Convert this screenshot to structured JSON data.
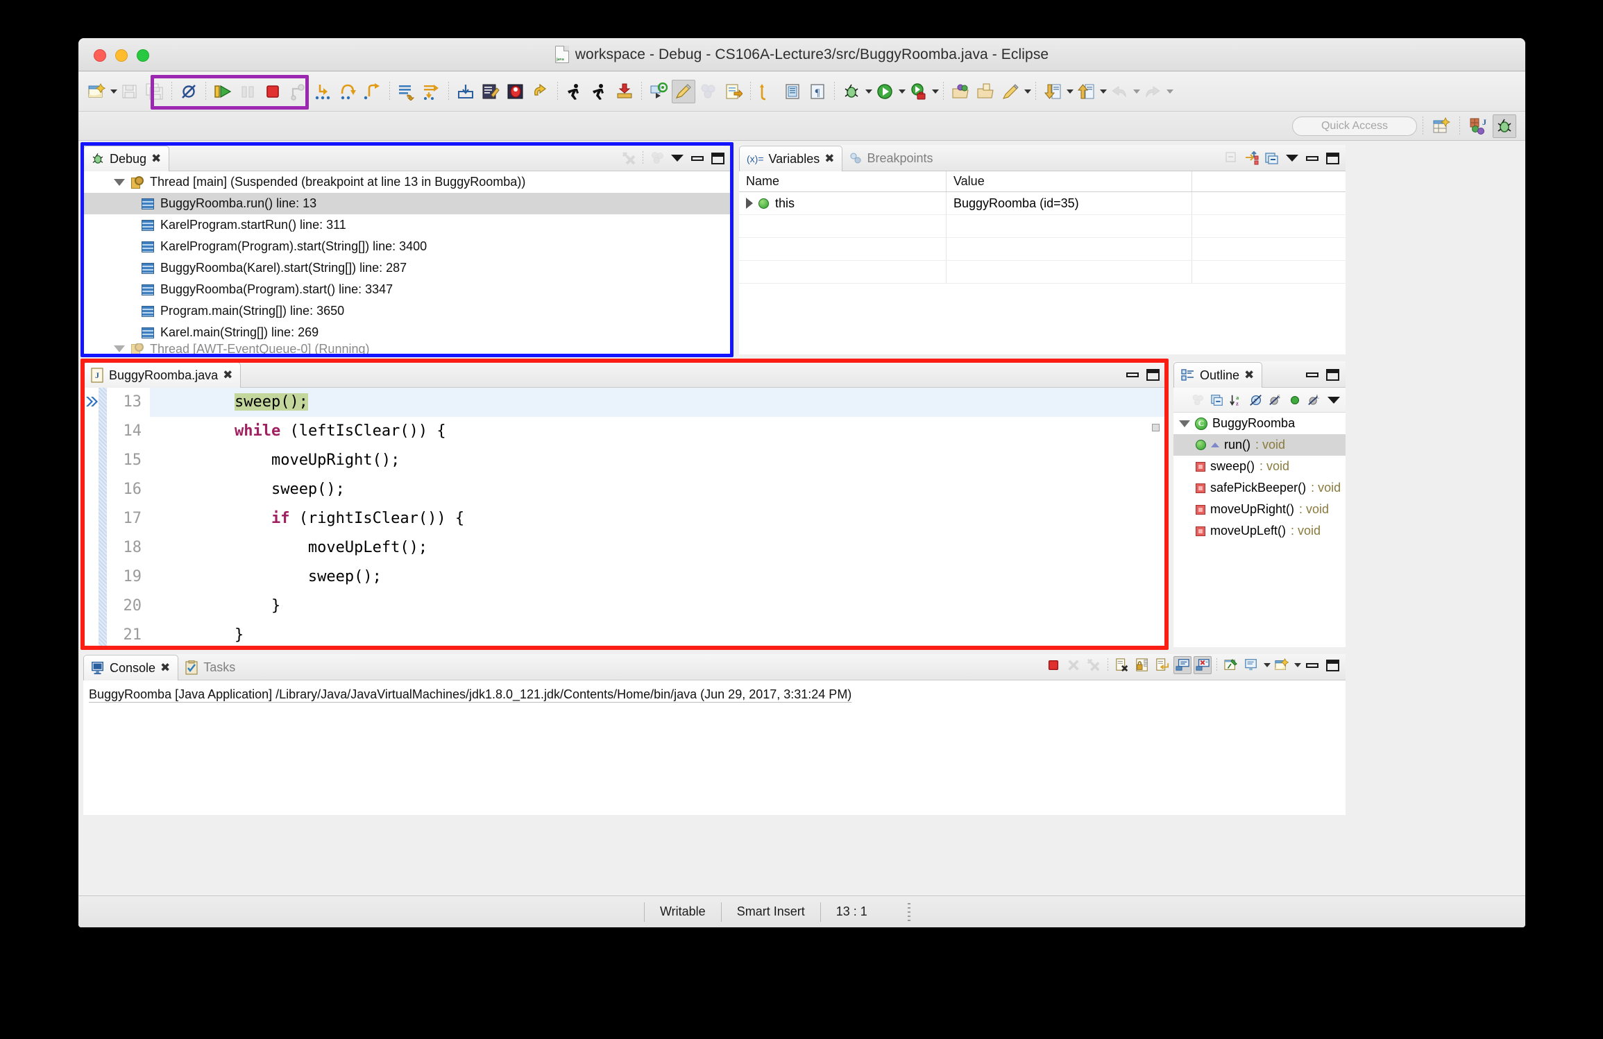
{
  "window": {
    "title": "workspace - Debug - CS106A-Lecture3/src/BuggyRoomba.java - Eclipse",
    "title_icon": "java-file-icon"
  },
  "toolbar": {
    "quick_access_placeholder": "Quick Access",
    "left_items": [
      {
        "name": "new-wizard-button",
        "icon": "new-document-icon",
        "has_dropdown": true,
        "enabled": true
      },
      {
        "name": "save-button",
        "icon": "save-disk-icon",
        "enabled": false
      },
      {
        "name": "save-all-button",
        "icon": "save-all-disks-icon",
        "enabled": false
      },
      {
        "name": "skip-all-breakpoints-button",
        "icon": "breakpoint-skip-icon",
        "enabled": true
      }
    ],
    "debug_controls": [
      {
        "name": "resume-button",
        "icon": "resume-play-icon",
        "enabled": true
      },
      {
        "name": "suspend-button",
        "icon": "suspend-pause-icon",
        "enabled": false
      },
      {
        "name": "terminate-button",
        "icon": "terminate-stop-icon",
        "enabled": true
      },
      {
        "name": "disconnect-button",
        "icon": "disconnect-icon",
        "enabled": false
      },
      {
        "name": "step-into-button",
        "icon": "step-into-arrow-icon",
        "enabled": true
      },
      {
        "name": "step-over-button",
        "icon": "step-over-arrow-icon",
        "enabled": true
      },
      {
        "name": "step-return-button",
        "icon": "step-return-arrow-icon",
        "enabled": true
      }
    ],
    "right_items": [
      {
        "name": "next-annotation-button",
        "icon": "next-annotation-icon"
      },
      {
        "name": "step-by-step-button",
        "icon": "step-filter-icon"
      },
      {
        "name": "open-type-button",
        "icon": "open-type-icon"
      },
      {
        "name": "new-java-project-button",
        "icon": "new-java-project-icon"
      },
      {
        "name": "debug-perspective-button",
        "icon": "bug-red-icon"
      },
      {
        "name": "toggle-mark-occurrences-button",
        "icon": "yellow-arrows-icon"
      },
      {
        "name": "run-last-tool-button",
        "icon": "running-man-icon"
      },
      {
        "name": "external-tools-button",
        "icon": "running-man-2-icon"
      },
      {
        "name": "build-button",
        "icon": "build-download-icon"
      },
      {
        "name": "new-class-button",
        "icon": "new-class-icon"
      },
      {
        "name": "toggle-highlight-button",
        "icon": "paintbrush-icon",
        "pressed": true
      },
      {
        "name": "coverage-button",
        "icon": "coverage-spheres-icon",
        "enabled": false
      },
      {
        "name": "open-task-button",
        "icon": "open-task-icon"
      },
      {
        "name": "open-terminal-button",
        "icon": "terminal-icon"
      },
      {
        "name": "show-whitespace-button",
        "icon": "pilcrow-icon"
      },
      {
        "name": "debug-launch-button",
        "icon": "bug-green-icon",
        "has_dropdown": true
      },
      {
        "name": "run-launch-button",
        "icon": "run-green-circle-icon",
        "has_dropdown": true
      },
      {
        "name": "run-as-test-button",
        "icon": "run-toolbox-icon",
        "has_dropdown": true
      },
      {
        "name": "open-package-button",
        "icon": "folder-spheres-icon"
      },
      {
        "name": "open-resource-button",
        "icon": "folder-clipboard-icon"
      },
      {
        "name": "annotate-button",
        "icon": "pen-icon",
        "has_dropdown": true
      },
      {
        "name": "previous-edit-button",
        "icon": "down-arrow-doc-icon",
        "has_dropdown": true
      },
      {
        "name": "next-edit-button",
        "icon": "up-arrow-doc-icon",
        "has_dropdown": true
      },
      {
        "name": "back-button",
        "icon": "back-arrow-icon",
        "enabled": false,
        "has_dropdown": true
      },
      {
        "name": "forward-button",
        "icon": "forward-arrow-icon",
        "enabled": false,
        "has_dropdown": true
      }
    ],
    "perspective_items": [
      {
        "name": "open-perspective-button",
        "icon": "open-perspective-icon"
      },
      {
        "name": "java-perspective-button",
        "icon": "java-perspective-icon"
      },
      {
        "name": "debug-perspective-tab",
        "icon": "bug-green-icon",
        "pressed": true
      }
    ]
  },
  "debug_view": {
    "tab_label": "Debug",
    "tab_icon": "bug-green-icon",
    "toolbar": [
      {
        "name": "remove-all-terminated-button",
        "icon": "remove-terminated-x-icon",
        "enabled": false
      },
      {
        "name": "coverage-spheres-button",
        "icon": "coverage-spheres-icon",
        "enabled": false
      },
      {
        "name": "view-menu-button",
        "icon": "view-menu-triangle-icon"
      },
      {
        "name": "minimize-button",
        "icon": "minimize-icon"
      },
      {
        "name": "maximize-button",
        "icon": "maximize-icon"
      }
    ],
    "thread_label": "Thread [main] (Suspended (breakpoint at line 13 in BuggyRoomba))",
    "stack_frames": [
      {
        "label": "BuggyRoomba.run() line: 13",
        "selected": true
      },
      {
        "label": "KarelProgram.startRun() line: 311",
        "selected": false
      },
      {
        "label": "KarelProgram(Program).start(String[]) line: 3400",
        "selected": false
      },
      {
        "label": "BuggyRoomba(Karel).start(String[]) line: 287",
        "selected": false
      },
      {
        "label": "BuggyRoomba(Program).start() line: 3347",
        "selected": false
      },
      {
        "label": "Program.main(String[]) line: 3650",
        "selected": false
      },
      {
        "label": "Karel.main(String[]) line: 269",
        "selected": false
      }
    ],
    "partial_row": "Thread [AWT-EventQueue-0] (Running)"
  },
  "variables_view": {
    "tabs": [
      {
        "label": "Variables",
        "icon": "variables-xy-icon",
        "active": true
      },
      {
        "label": "Breakpoints",
        "icon": "breakpoints-dots-icon",
        "active": false
      }
    ],
    "toolbar": [
      {
        "name": "collapse-all-button",
        "icon": "collapse-all-icon",
        "enabled": false
      },
      {
        "name": "show-logical-structure-button",
        "icon": "logical-structure-icon"
      },
      {
        "name": "collapse-all-vars-button",
        "icon": "collapse-panels-icon"
      },
      {
        "name": "view-menu-button",
        "icon": "view-menu-triangle-icon"
      },
      {
        "name": "minimize-button",
        "icon": "minimize-icon"
      },
      {
        "name": "maximize-button",
        "icon": "maximize-icon"
      }
    ],
    "columns": [
      "Name",
      "Value"
    ],
    "rows": [
      {
        "name": "this",
        "value": "BuggyRoomba  (id=35)",
        "expandable": true
      }
    ]
  },
  "editor": {
    "tab_label": "BuggyRoomba.java",
    "tab_icon": "java-source-icon",
    "buttons": [
      {
        "name": "minimize-button",
        "icon": "minimize-icon"
      },
      {
        "name": "maximize-button",
        "icon": "maximize-icon"
      }
    ],
    "lines": [
      {
        "num": "13",
        "indent": 8,
        "text": "sweep();",
        "highlight": "green",
        "current": true,
        "breakpoint": true
      },
      {
        "num": "14",
        "indent": 8,
        "text": "while (leftIsClear()) {",
        "keyword": "while"
      },
      {
        "num": "15",
        "indent": 12,
        "text": "moveUpRight();"
      },
      {
        "num": "16",
        "indent": 12,
        "text": "sweep();"
      },
      {
        "num": "17",
        "indent": 12,
        "text": "if (rightIsClear()) {",
        "keyword": "if"
      },
      {
        "num": "18",
        "indent": 16,
        "text": "moveUpLeft();"
      },
      {
        "num": "19",
        "indent": 16,
        "text": "sweep();"
      },
      {
        "num": "20",
        "indent": 12,
        "text": "}"
      },
      {
        "num": "21",
        "indent": 8,
        "text": "}"
      }
    ]
  },
  "outline_view": {
    "tab_label": "Outline",
    "tab_icon": "outline-tree-icon",
    "buttons": [
      {
        "name": "minimize-button",
        "icon": "minimize-icon"
      },
      {
        "name": "maximize-button",
        "icon": "maximize-icon"
      }
    ],
    "toolbar": [
      {
        "name": "focus-on-active-task-button",
        "icon": "coverage-spheres-icon",
        "enabled": false
      },
      {
        "name": "collapse-all-button",
        "icon": "collapse-all-icon"
      },
      {
        "name": "sort-button",
        "icon": "sort-az-icon"
      },
      {
        "name": "hide-fields-button",
        "icon": "hide-fields-icon"
      },
      {
        "name": "hide-static-button",
        "icon": "hide-static-icon"
      },
      {
        "name": "hide-public-button",
        "icon": "hide-public-icon"
      },
      {
        "name": "hide-local-types-button",
        "icon": "hide-local-types-icon"
      },
      {
        "name": "view-menu-button",
        "icon": "view-menu-triangle-icon"
      }
    ],
    "root": {
      "label": "BuggyRoomba",
      "icon": "java-class-icon"
    },
    "members": [
      {
        "label": "run()",
        "return_type": ": void",
        "icon": "public-method-icon",
        "selected": true,
        "overrides": true
      },
      {
        "label": "sweep()",
        "return_type": ": void",
        "icon": "private-method-icon",
        "selected": false
      },
      {
        "label": "safePickBeeper()",
        "return_type": ": void",
        "icon": "private-method-icon",
        "selected": false
      },
      {
        "label": "moveUpRight()",
        "return_type": ": void",
        "icon": "private-method-icon",
        "selected": false
      },
      {
        "label": "moveUpLeft()",
        "return_type": ": void",
        "icon": "private-method-icon",
        "selected": false
      }
    ]
  },
  "console_view": {
    "tabs": [
      {
        "label": "Console",
        "icon": "console-monitor-icon",
        "active": true
      },
      {
        "label": "Tasks",
        "icon": "tasks-clipboard-icon",
        "active": false
      }
    ],
    "toolbar": [
      {
        "name": "terminate-button",
        "icon": "terminate-stop-icon"
      },
      {
        "name": "remove-launch-button",
        "icon": "remove-x-icon",
        "enabled": false
      },
      {
        "name": "remove-all-launches-button",
        "icon": "remove-all-x-icon",
        "enabled": false
      },
      {
        "name": "clear-console-button",
        "icon": "clear-console-icon"
      },
      {
        "name": "scroll-lock-button",
        "icon": "scroll-lock-padlock-icon"
      },
      {
        "name": "word-wrap-button",
        "icon": "word-wrap-icon"
      },
      {
        "name": "show-console-on-output-button",
        "icon": "show-console-out-icon",
        "pressed": true
      },
      {
        "name": "show-console-on-error-button",
        "icon": "show-console-err-icon",
        "pressed": true
      },
      {
        "name": "pin-console-button",
        "icon": "pin-icon"
      },
      {
        "name": "display-selected-console-button",
        "icon": "display-console-icon",
        "has_dropdown": true
      },
      {
        "name": "open-console-button",
        "icon": "open-console-icon",
        "has_dropdown": true
      },
      {
        "name": "minimize-button",
        "icon": "minimize-icon"
      },
      {
        "name": "maximize-button",
        "icon": "maximize-icon"
      }
    ],
    "output_line": "BuggyRoomba [Java Application] /Library/Java/JavaVirtualMachines/jdk1.8.0_121.jdk/Contents/Home/bin/java (Jun 29, 2017, 3:31:24 PM)"
  },
  "statusbar": {
    "writable": "Writable",
    "insert_mode": "Smart Insert",
    "position": "13 : 1"
  },
  "annotations": {
    "purple_box_color": "#9c27b0",
    "blue_box_color": "#1414ff",
    "red_box_color": "#fa1e14"
  }
}
